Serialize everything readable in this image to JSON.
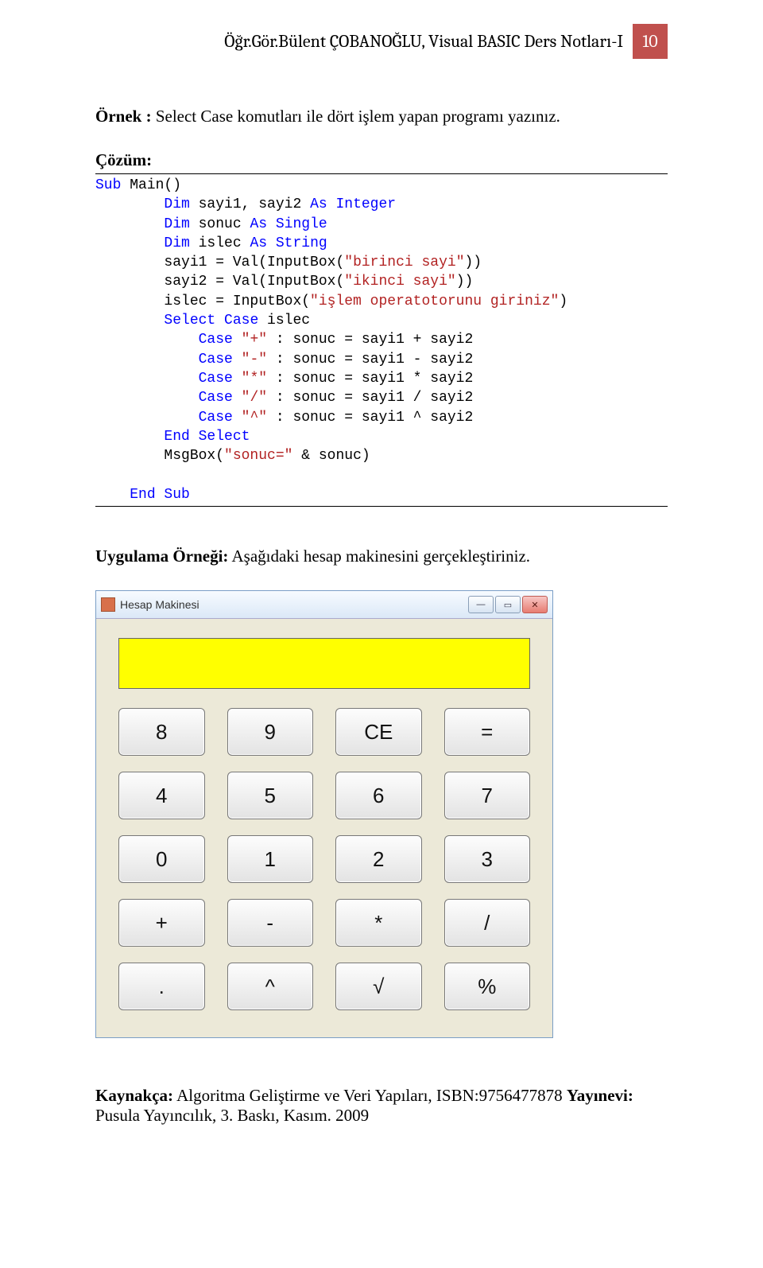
{
  "header": {
    "title": "Öğr.Gör.Bülent ÇOBANOĞLU, Visual BASIC Ders Notları-I",
    "pageNumber": "10"
  },
  "example": {
    "prefix": "Örnek : ",
    "text": "Select Case komutları ile dört işlem yapan programı yazınız."
  },
  "solutionLabel": "Çözüm:",
  "code": {
    "l1a": "Sub",
    "l1b": " Main()",
    "l2a": "Dim",
    "l2b": " sayi1, sayi2 ",
    "l2c": "As Integer",
    "l3a": "Dim",
    "l3b": " sonuc ",
    "l3c": "As Single",
    "l4a": "Dim",
    "l4b": " islec ",
    "l4c": "As String",
    "l5a": "        sayi1 = Val(InputBox(",
    "l5s": "\"birinci sayi\"",
    "l5b": "))",
    "l6a": "        sayi2 = Val(InputBox(",
    "l6s": "\"ikinci sayi\"",
    "l6b": "))",
    "l7a": "        islec = InputBox(",
    "l7s": "\"işlem operatotorunu giriniz\"",
    "l7b": ")",
    "l8a": "Select Case",
    "l8b": " islec",
    "l9a": "Case ",
    "l9s": "\"+\"",
    "l9b": " : sonuc = sayi1 + sayi2",
    "l10a": "Case ",
    "l10s": "\"-\"",
    "l10b": " : sonuc = sayi1 - sayi2",
    "l11a": "Case ",
    "l11s": "\"*\"",
    "l11b": " : sonuc = sayi1 * sayi2",
    "l12a": "Case ",
    "l12s": "\"/\"",
    "l12b": " : sonuc = sayi1 / sayi2",
    "l13a": "Case ",
    "l13s": "\"^\"",
    "l13b": " : sonuc = sayi1 ^ sayi2",
    "l14": "End Select",
    "l15a": "        MsgBox(",
    "l15s": "\"sonuc=\"",
    "l15b": " & sonuc)",
    "l16": "End Sub"
  },
  "exerciseLabel": "Uygulama Örneği:",
  "exerciseText": " Aşağıdaki hesap makinesini gerçekleştiriniz.",
  "calc": {
    "title": "Hesap Makinesi",
    "minLabel": "—",
    "maxLabel": "▭",
    "closeLabel": "✕",
    "buttons": [
      "8",
      "9",
      "CE",
      "=",
      "4",
      "5",
      "6",
      "7",
      "0",
      "1",
      "2",
      "3",
      "+",
      "-",
      "*",
      "/",
      ".",
      "^",
      "√",
      "%"
    ]
  },
  "citation": {
    "kaynakLabel": "Kaynakça:",
    "kaynakText": " Algoritma Geliştirme ve Veri Yapıları, ISBN:9756477878 ",
    "yayineviLabel": "Yayınevi:",
    "yayineviText": " Pusula Yayıncılık, 3. Baskı, Kasım. 2009"
  }
}
